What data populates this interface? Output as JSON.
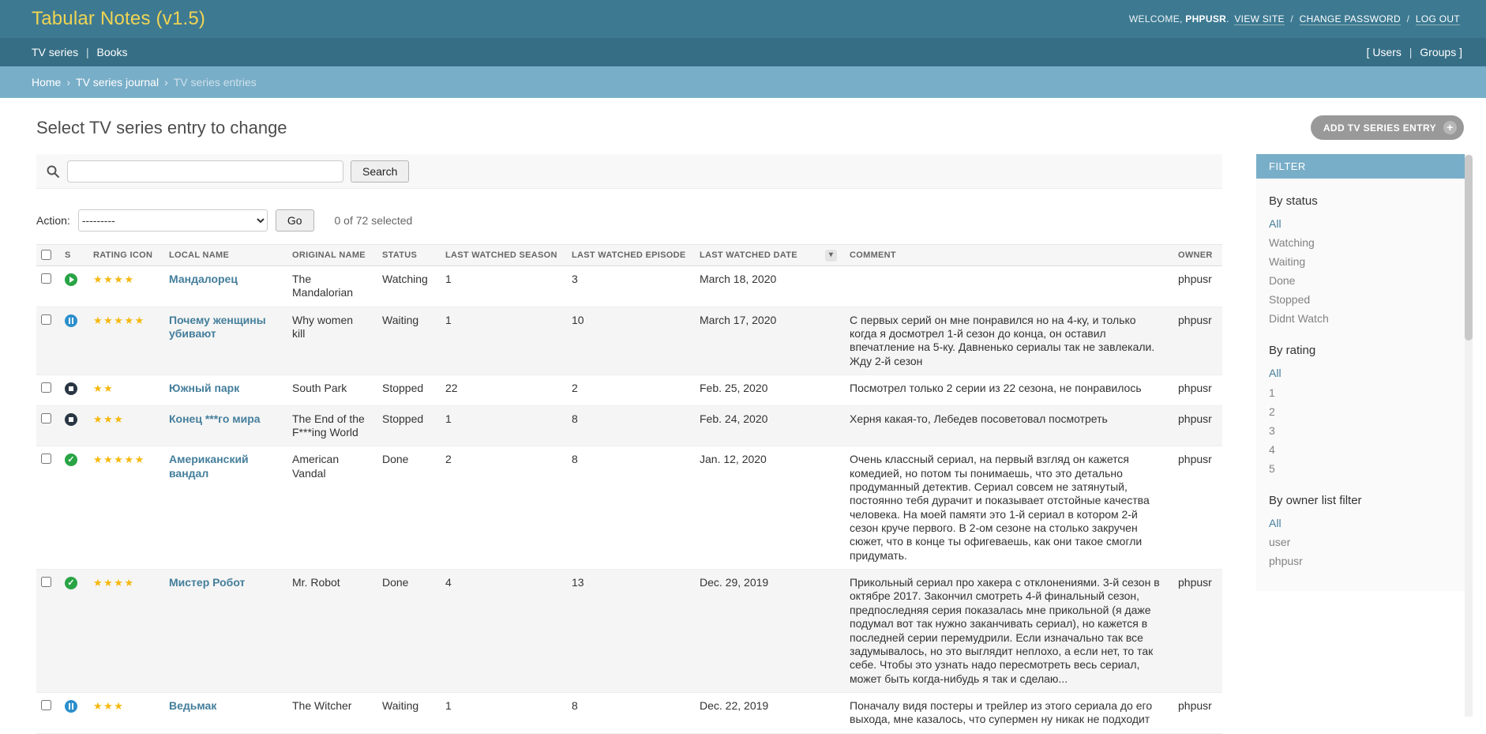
{
  "colors": {
    "header_bar": "#3d7a92",
    "nav_bar": "#366e85",
    "breadcrumb_bar": "#79aec8",
    "site_title_yellow": "#f0d453",
    "link_blue": "#447e9b",
    "star_gold": "#f6b80e",
    "status_play_green": "#28a445",
    "status_pause_blue": "#2b8fcc",
    "status_stop_dark": "#2a3642",
    "status_done_green": "#28a445"
  },
  "header": {
    "site_title": "Tabular Notes (v1.5)",
    "welcome_prefix": "WELCOME,",
    "username": "PHPUSR",
    "username_suffix": ".",
    "view_site": "VIEW SITE",
    "sep1": "/",
    "change_password": "CHANGE PASSWORD",
    "sep2": "/",
    "log_out": "LOG OUT"
  },
  "nav": {
    "tv_series": "TV series",
    "separator": "|",
    "books": "Books",
    "bracket_open": "[",
    "users": "Users",
    "right_separator": "|",
    "groups": "Groups",
    "bracket_close": "]"
  },
  "breadcrumbs": {
    "separator": "›",
    "items": [
      "Home",
      "TV series journal",
      "TV series entries"
    ]
  },
  "page": {
    "title": "Select TV series entry to change",
    "add_button": "ADD TV SERIES ENTRY"
  },
  "search": {
    "value": "",
    "button": "Search"
  },
  "actions": {
    "label": "Action:",
    "selected_option": "---------",
    "go_button": "Go",
    "counter": "0 of 72 selected"
  },
  "table": {
    "star_char": "★",
    "columns": [
      {
        "label": "S"
      },
      {
        "label": "RATING ICON"
      },
      {
        "label": "LOCAL NAME"
      },
      {
        "label": "ORIGINAL NAME"
      },
      {
        "label": "STATUS"
      },
      {
        "label": "LAST WATCHED SEASON"
      },
      {
        "label": "LAST WATCHED EPISODE"
      },
      {
        "label": "LAST WATCHED DATE",
        "sorted": true
      },
      {
        "label": "COMMENT"
      },
      {
        "label": "OWNER"
      }
    ],
    "rows": [
      {
        "status_icon": "play",
        "rating": 4,
        "local_name": "Мандалорец",
        "original_name": "The Mandalorian",
        "status": "Watching",
        "season": "1",
        "episode": "3",
        "date": "March 18, 2020",
        "comment": "",
        "owner": "phpusr"
      },
      {
        "status_icon": "pause",
        "rating": 5,
        "local_name": "Почему женщины убивают",
        "original_name": "Why women kill",
        "status": "Waiting",
        "season": "1",
        "episode": "10",
        "date": "March 17, 2020",
        "comment": "С первых серий он мне понравился но на 4-ку, и только когда я досмотрел 1-й сезон до конца, он оставил впечатление на 5-ку. Давненько сериалы так не завлекали. Жду 2-й сезон",
        "owner": "phpusr"
      },
      {
        "status_icon": "stop",
        "rating": 2,
        "local_name": "Южный парк",
        "original_name": "South Park",
        "status": "Stopped",
        "season": "22",
        "episode": "2",
        "date": "Feb. 25, 2020",
        "comment": "Посмотрел только 2 серии из 22 сезона, не понравилось",
        "owner": "phpusr"
      },
      {
        "status_icon": "stop",
        "rating": 3,
        "local_name": "Конец ***го мира",
        "original_name": "The End of the F***ing World",
        "status": "Stopped",
        "season": "1",
        "episode": "8",
        "date": "Feb. 24, 2020",
        "comment": "Херня какая-то, Лебедев посоветовал посмотреть",
        "owner": "phpusr"
      },
      {
        "status_icon": "check",
        "rating": 5,
        "local_name": "Американский вандал",
        "original_name": "American Vandal",
        "status": "Done",
        "season": "2",
        "episode": "8",
        "date": "Jan. 12, 2020",
        "comment": "Очень классный сериал, на первый взгляд он кажется комедией, но потом ты понимаешь, что это детально продуманный детектив. Сериал совсем не затянутый, постоянно тебя дурачит и показывает отстойные качества человека. На моей памяти это 1-й сериал в котором 2-й сезон круче первого. В 2-ом сезоне на столько закручен сюжет, что в конце ты офигеваешь, как они такое смогли придумать.",
        "owner": "phpusr"
      },
      {
        "status_icon": "check",
        "rating": 4,
        "local_name": "Мистер Робот",
        "original_name": "Mr. Robot",
        "status": "Done",
        "season": "4",
        "episode": "13",
        "date": "Dec. 29, 2019",
        "comment": "Прикольный сериал про хакера с отклонениями. 3-й сезон в октябре 2017. Закончил смотреть 4-й финальный сезон, предпоследняя серия показалась мне прикольной (я даже подумал вот так нужно заканчивать сериал), но кажется в последней серии перемудрили. Если изначально так все задумывалось, но это выглядит неплохо, а если нет, то так себе. Чтобы это узнать надо пересмотреть весь сериал, может быть когда-нибудь я так и сделаю...",
        "owner": "phpusr"
      },
      {
        "status_icon": "pause",
        "rating": 3,
        "local_name": "Ведьмак",
        "original_name": "The Witcher",
        "status": "Waiting",
        "season": "1",
        "episode": "8",
        "date": "Dec. 22, 2019",
        "comment": "Поначалу видя постеры и трейлер из этого сериала до его выхода, мне казалось, что супермен ну никак не подходит",
        "owner": "phpusr"
      }
    ]
  },
  "filter": {
    "title": "FILTER",
    "groups": [
      {
        "title": "By status",
        "options": [
          {
            "label": "All",
            "selected": true
          },
          {
            "label": "Watching"
          },
          {
            "label": "Waiting"
          },
          {
            "label": "Done"
          },
          {
            "label": "Stopped"
          },
          {
            "label": "Didnt Watch"
          }
        ]
      },
      {
        "title": "By rating",
        "options": [
          {
            "label": "All",
            "selected": true
          },
          {
            "label": "1"
          },
          {
            "label": "2"
          },
          {
            "label": "3"
          },
          {
            "label": "4"
          },
          {
            "label": "5"
          }
        ]
      },
      {
        "title": "By owner list filter",
        "options": [
          {
            "label": "All",
            "selected": true
          },
          {
            "label": "user"
          },
          {
            "label": "phpusr"
          }
        ]
      }
    ]
  }
}
